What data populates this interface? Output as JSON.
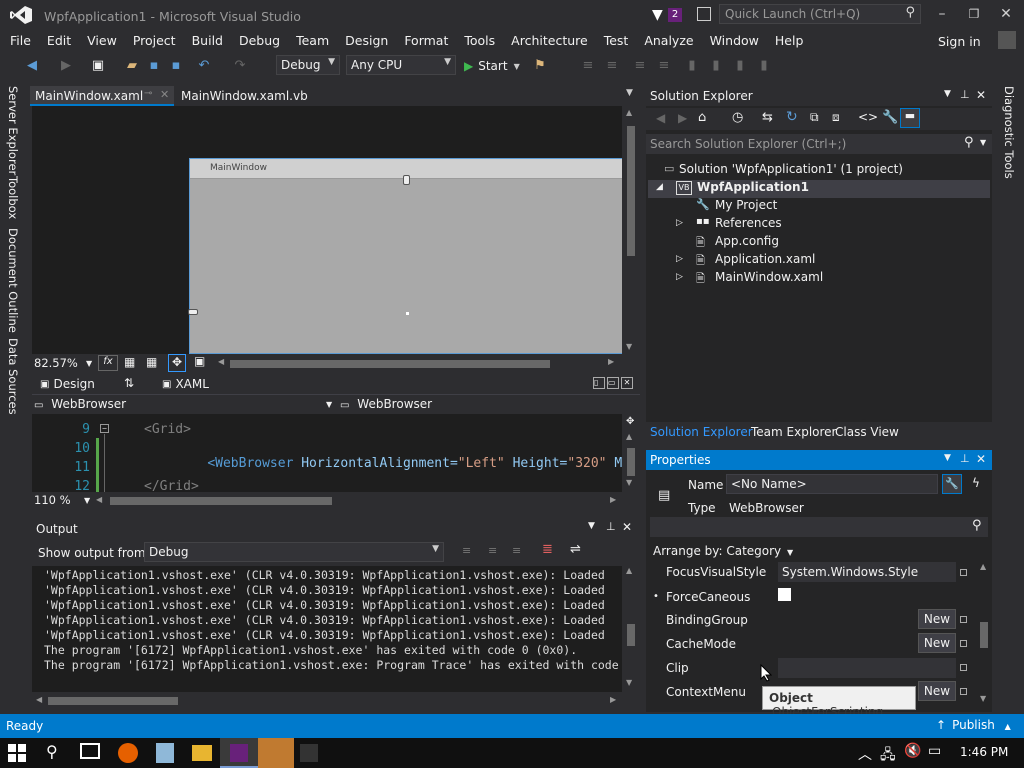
{
  "window": {
    "title": "WpfApplication1 - Microsoft Visual Studio",
    "notification_count": "2",
    "quick_launch_placeholder": "Quick Launch (Ctrl+Q)",
    "sign_in": "Sign in"
  },
  "menu": [
    "File",
    "Edit",
    "View",
    "Project",
    "Build",
    "Debug",
    "Team",
    "Design",
    "Format",
    "Tools",
    "Architecture",
    "Test",
    "Analyze",
    "Window",
    "Help"
  ],
  "toolbar": {
    "config": "Debug",
    "platform": "Any CPU",
    "start": "Start"
  },
  "left_tabs": [
    "Server Explorer",
    "Toolbox",
    "Document Outline",
    "Data Sources"
  ],
  "right_tabs": [
    "Diagnostic Tools"
  ],
  "doc_tabs": [
    "MainWindow.xaml",
    "MainWindow.xaml.vb"
  ],
  "designer": {
    "window_title": "MainWindow",
    "zoom": "82.57%",
    "design_tab": "Design",
    "xaml_tab": "XAML"
  },
  "code_editor": {
    "left_dropdown": "WebBrowser",
    "right_dropdown": "WebBrowser",
    "zoom": "110 %",
    "lines": [
      {
        "num": "9",
        "text": "<Grid>"
      },
      {
        "num": "10",
        "tag": "<WebBrowser",
        "attr1": " HorizontalAlignment=",
        "val1": "\"Left\"",
        "attr2": " Height=",
        "val2": "\"320\"",
        "attr3": " Margi"
      },
      {
        "num": "11",
        "text": ""
      },
      {
        "num": "12",
        "text": "</Grid>"
      }
    ]
  },
  "output": {
    "title": "Output",
    "show_from_label": "Show output from:",
    "source": "Debug",
    "lines": [
      "'WpfApplication1.vshost.exe' (CLR v4.0.30319: WpfApplication1.vshost.exe): Loaded",
      "'WpfApplication1.vshost.exe' (CLR v4.0.30319: WpfApplication1.vshost.exe): Loaded",
      "'WpfApplication1.vshost.exe' (CLR v4.0.30319: WpfApplication1.vshost.exe): Loaded",
      "'WpfApplication1.vshost.exe' (CLR v4.0.30319: WpfApplication1.vshost.exe): Loaded",
      "'WpfApplication1.vshost.exe' (CLR v4.0.30319: WpfApplication1.vshost.exe): Loaded",
      "The program '[6172] WpfApplication1.vshost.exe' has exited with code 0 (0x0).",
      "The program '[6172] WpfApplication1.vshost.exe: Program Trace' has exited with code"
    ]
  },
  "solution_explorer": {
    "title": "Solution Explorer",
    "search_placeholder": "Search Solution Explorer (Ctrl+;)",
    "solution": "Solution 'WpfApplication1' (1 project)",
    "project": "WpfApplication1",
    "items": [
      "My Project",
      "References",
      "App.config",
      "Application.xaml",
      "MainWindow.xaml"
    ],
    "bottom_tabs": [
      "Solution Explorer",
      "Team Explorer",
      "Class View"
    ]
  },
  "properties": {
    "title": "Properties",
    "name_label": "Name",
    "name_value": "<No Name>",
    "type_label": "Type",
    "type_value": "WebBrowser",
    "arrange_by": "Arrange by: Category",
    "rows": [
      {
        "label": "FocusVisualStyle",
        "value": "System.Windows.Style"
      },
      {
        "label": "ForceCaneous",
        "value": ""
      },
      {
        "label": "BindingGroup",
        "value": "New"
      },
      {
        "label": "CacheMode",
        "value": "New"
      },
      {
        "label": "Clip",
        "value": ""
      },
      {
        "label": "ContextMenu",
        "value": "New"
      }
    ],
    "tooltip_bold": "Object",
    "tooltip_text": "ObjectForScripting"
  },
  "status": {
    "left": "Ready",
    "right": "Publish"
  },
  "taskbar": {
    "time": "1:46 PM"
  },
  "colors": {
    "accent": "#007acc",
    "vs_purple": "#68217a",
    "statusbar": "#007acc"
  }
}
